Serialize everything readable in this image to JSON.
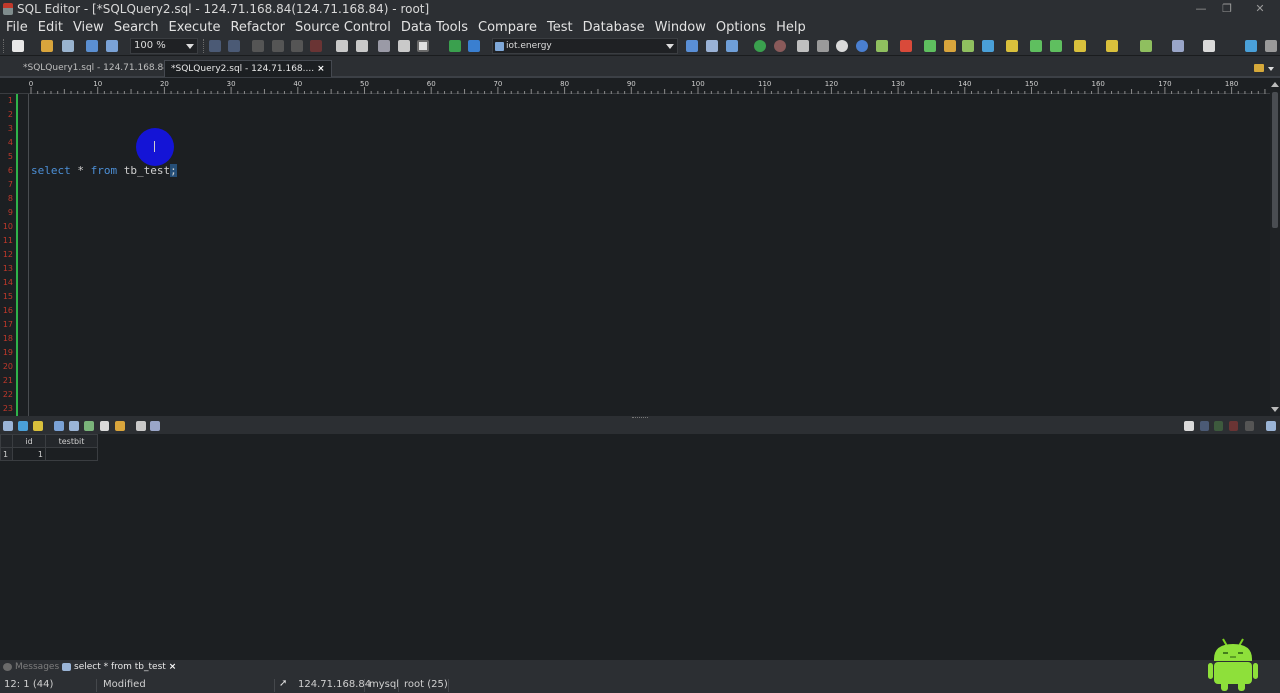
{
  "window": {
    "title": "SQL Editor - [*SQLQuery2.sql - 124.71.168.84(124.71.168.84) - root]",
    "controls": [
      "minimize",
      "restore",
      "close"
    ]
  },
  "menu": [
    "File",
    "Edit",
    "View",
    "Search",
    "Execute",
    "Refactor",
    "Source Control",
    "Data Tools",
    "Compare",
    "Test",
    "Database",
    "Window",
    "Options",
    "Help"
  ],
  "toolbar": {
    "zoom": "100 %",
    "database": "iot.energy"
  },
  "tabs": [
    {
      "label": "*SQLQuery1.sql - 124.71.168.84...",
      "active": false
    },
    {
      "label": "*SQLQuery2.sql - 124.71.168....",
      "active": true,
      "close": "×"
    }
  ],
  "ruler": {
    "labels": [
      "0",
      "10",
      "20",
      "30",
      "40",
      "50",
      "60",
      "70",
      "80",
      "90",
      "100",
      "110",
      "120",
      "130",
      "140",
      "150",
      "160",
      "170",
      "180"
    ]
  },
  "editor": {
    "line_numbers": [
      "1",
      "2",
      "3",
      "4",
      "5",
      "6",
      "7",
      "8",
      "9",
      "10",
      "11",
      "12",
      "13",
      "14",
      "15",
      "16",
      "17",
      "18",
      "19",
      "20",
      "21",
      "22",
      "23"
    ],
    "code": {
      "kw1": "select",
      "star": " * ",
      "kw2": "from",
      "ident": " tb_test",
      "selected": ";"
    }
  },
  "results": {
    "columns": [
      "id",
      "testbit"
    ],
    "rows": [
      {
        "rownum": "1",
        "id": "1",
        "testbit": ""
      }
    ]
  },
  "bottom_tabs": [
    {
      "label": "Messages",
      "active": false
    },
    {
      "label": "select * from tb_test",
      "active": true,
      "close": "×"
    }
  ],
  "status": {
    "position": "12: 1 (44)",
    "state": "Modified",
    "host": "124.71.168.84",
    "driver": "mysql",
    "user": "root (25)"
  }
}
